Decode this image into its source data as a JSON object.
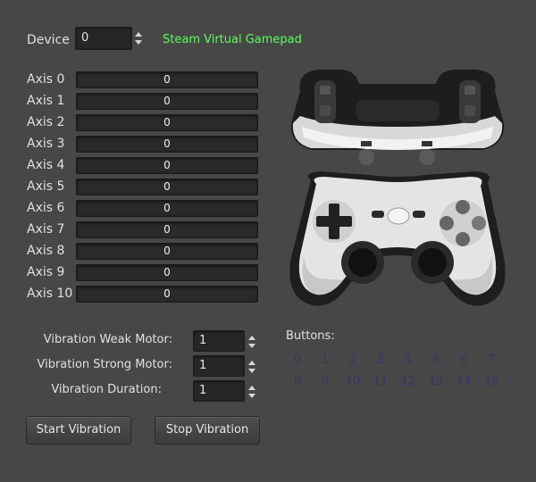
{
  "device": {
    "label": "Device",
    "value": "0",
    "name": "Steam Virtual Gamepad",
    "name_color": "#5cff5c"
  },
  "axes": [
    {
      "label": "Axis 0",
      "value": "0",
      "level": 0
    },
    {
      "label": "Axis 1",
      "value": "0",
      "level": 0
    },
    {
      "label": "Axis 2",
      "value": "0",
      "level": 0
    },
    {
      "label": "Axis 3",
      "value": "0",
      "level": 0
    },
    {
      "label": "Axis 4",
      "value": "0",
      "level": 0
    },
    {
      "label": "Axis 5",
      "value": "0",
      "level": 0
    },
    {
      "label": "Axis 6",
      "value": "0",
      "level": 0
    },
    {
      "label": "Axis 7",
      "value": "0",
      "level": 0
    },
    {
      "label": "Axis 8",
      "value": "0",
      "level": 0
    },
    {
      "label": "Axis 9",
      "value": "0",
      "level": 0
    },
    {
      "label": "Axis 10",
      "value": "0",
      "level": 0
    }
  ],
  "vibration": {
    "weak_label": "Vibration Weak Motor:",
    "weak_value": "1",
    "strong_label": "Vibration Strong Motor:",
    "strong_value": "1",
    "duration_label": "Vibration Duration:",
    "duration_value": "1",
    "start_label": "Start Vibration",
    "stop_label": "Stop Vibration"
  },
  "buttons": {
    "label": "Buttons:",
    "indices": [
      "0",
      "1",
      "2",
      "3",
      "4",
      "5",
      "6",
      "7",
      "8",
      "9",
      "10",
      "11",
      "12",
      "13",
      "14",
      "15"
    ],
    "inactive_color": "#3a3466"
  },
  "icons": {
    "spin_arrows": "up-down-arrow-icon",
    "gamepad": "gamepad-image"
  }
}
